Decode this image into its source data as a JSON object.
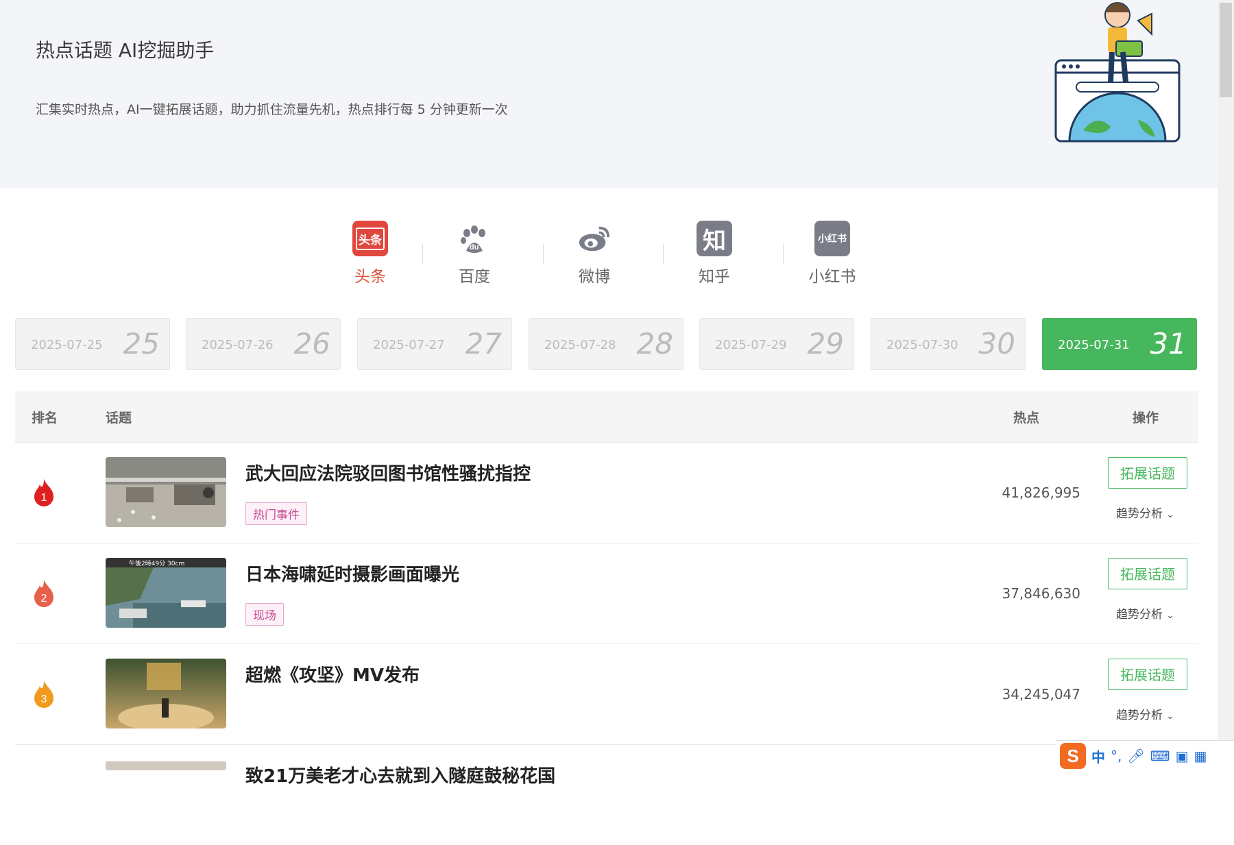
{
  "header": {
    "title": "热点话题 AI挖掘助手",
    "subtitle": "汇集实时热点，AI一键拓展话题，助力抓住流量先机，热点排行每 5 分钟更新一次"
  },
  "platforms": [
    {
      "label": "头条",
      "icon_text": "头条",
      "color": "#e0473d",
      "active": true
    },
    {
      "label": "百度",
      "icon": "baidu-paw-icon",
      "active": false
    },
    {
      "label": "微博",
      "icon": "weibo-icon",
      "active": false
    },
    {
      "label": "知乎",
      "icon_text": "知",
      "active": false
    },
    {
      "label": "小红书",
      "icon_text": "小红书",
      "active": false
    }
  ],
  "dates": [
    {
      "date": "2025-07-25",
      "day": "25"
    },
    {
      "date": "2025-07-26",
      "day": "26"
    },
    {
      "date": "2025-07-27",
      "day": "27"
    },
    {
      "date": "2025-07-28",
      "day": "28"
    },
    {
      "date": "2025-07-29",
      "day": "29"
    },
    {
      "date": "2025-07-30",
      "day": "30"
    },
    {
      "date": "2025-07-31",
      "day": "31",
      "active": true
    }
  ],
  "table": {
    "columns": {
      "rank": "排名",
      "topic": "话题",
      "heat": "热点",
      "action": "操作"
    },
    "rows": [
      {
        "rank": "1",
        "title": "武大回应法院驳回图书馆性骚扰指控",
        "tag": "热门事件",
        "heat": "41,826,995",
        "expand": "拓展话题",
        "trend": "趋势分析"
      },
      {
        "rank": "2",
        "title": "日本海啸延时摄影画面曝光",
        "tag": "现场",
        "heat": "37,846,630",
        "expand": "拓展话题",
        "trend": "趋势分析",
        "thumb_caption": "午後2時49分 30cm"
      },
      {
        "rank": "3",
        "title": "超燃《攻坚》MV发布",
        "tag": "",
        "heat": "34,245,047",
        "expand": "拓展话题",
        "trend": "趋势分析"
      },
      {
        "rank": "",
        "title": "致21万美老才心去就到入隧庭鼓秘花国"
      }
    ]
  },
  "ime": {
    "mode": "中"
  },
  "colors": {
    "accent": "#46b75c",
    "toutiao": "#e0473d",
    "rank1": "#e02020",
    "rank2": "#e8604c",
    "rank3": "#f19a1c",
    "tag": "#c74c95"
  }
}
